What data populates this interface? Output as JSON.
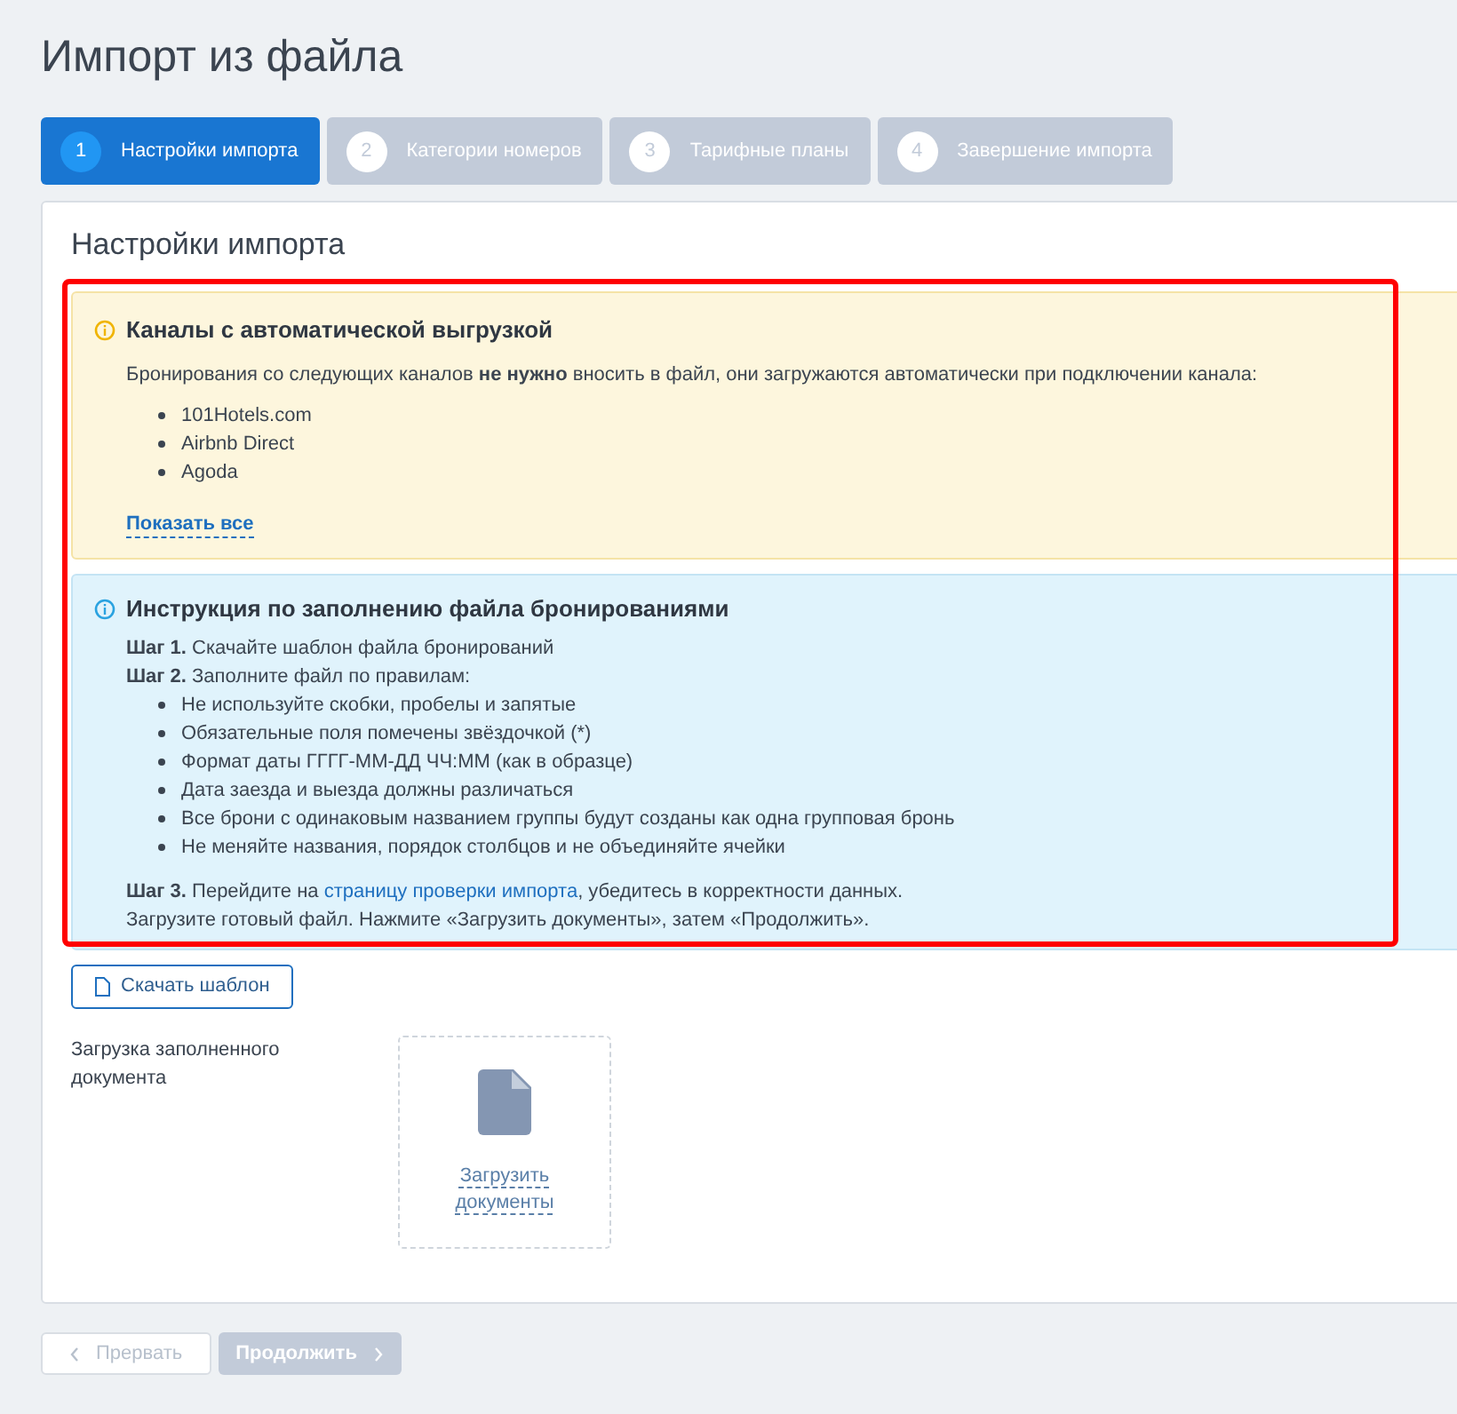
{
  "page_title": "Импорт из файла",
  "steps": [
    {
      "number": "1",
      "label": "Настройки импорта",
      "selected": true
    },
    {
      "number": "2",
      "label": "Категории номеров",
      "selected": false
    },
    {
      "number": "3",
      "label": "Тарифные планы",
      "selected": false
    },
    {
      "number": "4",
      "label": "Завершение импорта",
      "selected": false
    }
  ],
  "card_title": "Настройки импорта",
  "channels_notice": {
    "title": "Каналы с автоматической выгрузкой",
    "text": "Бронирования со следующих каналов **не нужно** вносить в файл, они загружаются автоматически при подключении канала:",
    "channels": [
      "101Hotels.com",
      "Airbnb Direct",
      "Agoda"
    ],
    "show_all": "Показать все"
  },
  "instruction": {
    "title": "Инструкция по заполнению файла бронированиями",
    "steps": [
      {
        "label": "Шаг 1.",
        "text": "Скачайте шаблон файла бронирований"
      },
      {
        "label": "Шаг 2.",
        "text": "Заполните файл по правилам:",
        "rules": [
          "Не используйте скобки, пробелы и запятые",
          "Обязательные поля помечены звёздочкой (*)",
          "Формат даты ГГГГ-ММ-ДД ЧЧ:ММ (как в образце)",
          "Дата заезда и выезда должны различаться",
          "Все брони с одинаковым названием группы будут созданы как одна групповая бронь",
          "Не меняйте названия, порядок столбцов и не объединяйте ячейки"
        ]
      },
      {
        "label": "Шаг 3.",
        "text": "Перейдите на ",
        "link": "страницу проверки импорта",
        "text_after": ", убедитесь в корректности данных.",
        "note": "Загрузите готовый файл. Нажмите «Загрузить документы», затем «Продолжить»."
      }
    ]
  },
  "download_template": "Скачать шаблон",
  "upload": {
    "label": "Загрузка заполненного документа",
    "action": "Загрузить документы"
  },
  "footer_buttons": [
    {
      "label": "Прервать",
      "kind": "back",
      "disabled": true
    },
    {
      "label": "Продолжить",
      "kind": "next",
      "disabled": true
    }
  ]
}
